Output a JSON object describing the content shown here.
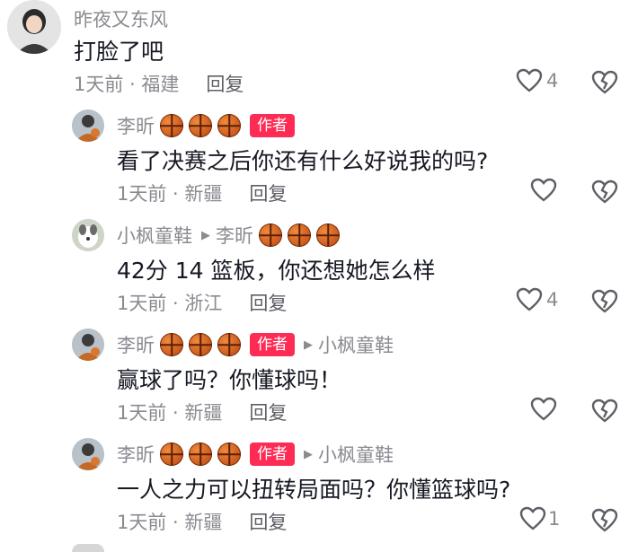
{
  "comments": [
    {
      "user": "昨夜又东风",
      "text": "打脸了吧",
      "meta": "1天前 · 福建",
      "reply": "回复",
      "likes": "4"
    },
    {
      "user": "李昕",
      "badge": "作者",
      "text": "看了决赛之后你还有什么好说我的吗?",
      "meta": "1天前 · 新疆",
      "reply": "回复",
      "likes": ""
    },
    {
      "user": "小枫童鞋",
      "reply_to": "李昕",
      "text": "42分 14 篮板，你还想她怎么样",
      "meta": "1天前 · 浙江",
      "reply": "回复",
      "likes": "4"
    },
    {
      "user": "李昕",
      "badge": "作者",
      "reply_to": "小枫童鞋",
      "text": "赢球了吗？你懂球吗！",
      "meta": "1天前 · 新疆",
      "reply": "回复",
      "likes": ""
    },
    {
      "user": "李昕",
      "badge": "作者",
      "reply_to": "小枫童鞋",
      "text": "一人之力可以扭转局面吗？你懂篮球吗?",
      "meta": "1天前 · 新疆",
      "reply": "回复",
      "likes": "1"
    }
  ],
  "icons": {
    "like": "heart-outline-icon",
    "dislike": "broken-heart-outline-icon",
    "reply_arrow": "triangle-right-icon",
    "emoji": "basketball-icon"
  },
  "colors": {
    "author_badge": "#fe2c55",
    "secondary_text": "#8a8b91",
    "primary_text": "#161823"
  }
}
